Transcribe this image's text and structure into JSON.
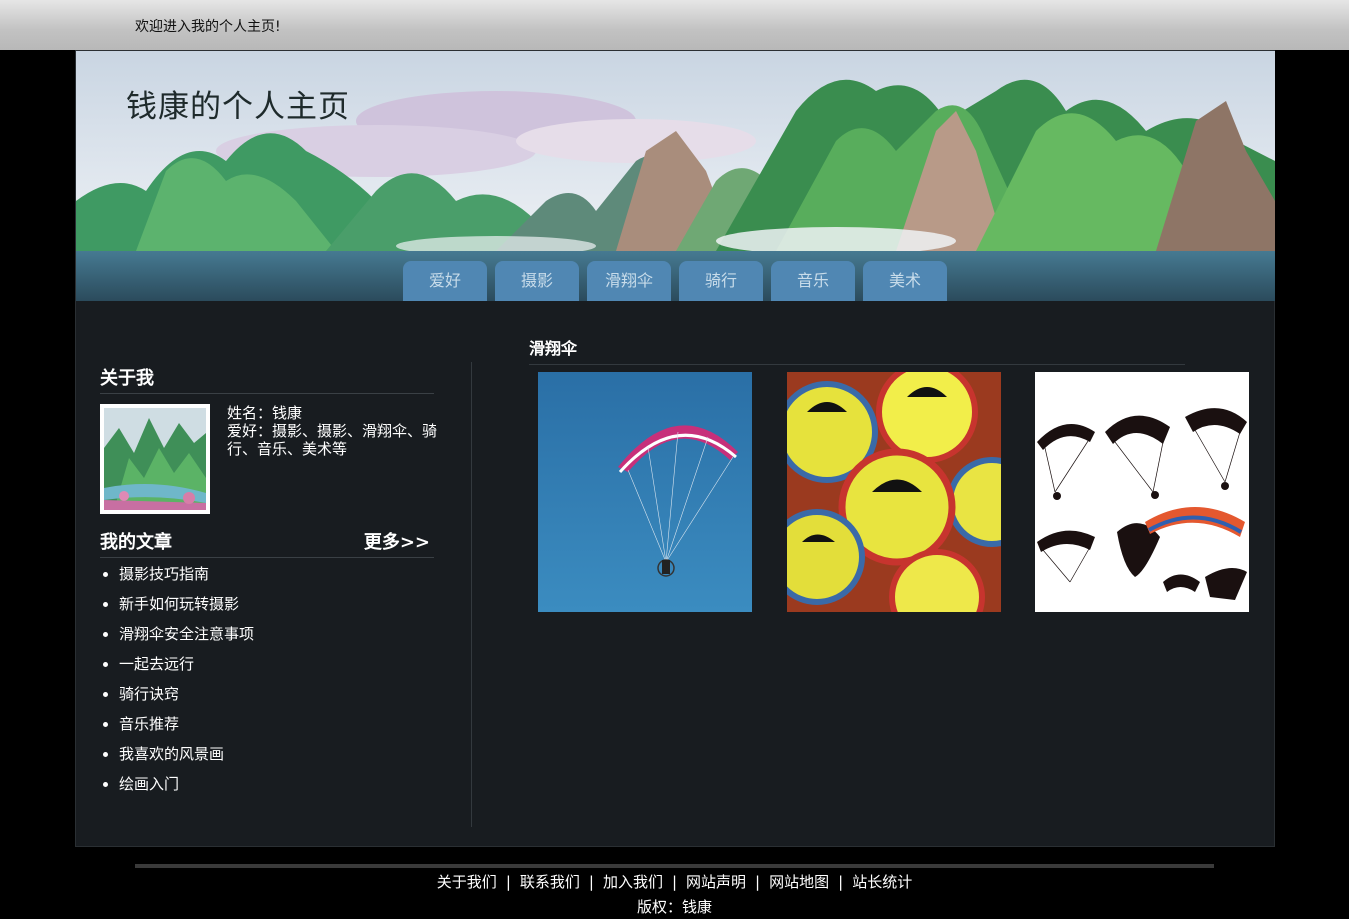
{
  "topbar": {
    "welcome": "欢迎进入我的个人主页!"
  },
  "header": {
    "site_title": "钱康的个人主页"
  },
  "nav": {
    "tabs": [
      {
        "label": "爱好"
      },
      {
        "label": "摄影"
      },
      {
        "label": "滑翔伞"
      },
      {
        "label": "骑行"
      },
      {
        "label": "音乐"
      },
      {
        "label": "美术"
      }
    ]
  },
  "about": {
    "title": "关于我",
    "name_line": "姓名：钱康",
    "hobby_line": "爱好：摄影、摄影、滑翔伞、骑行、音乐、美术等"
  },
  "articles": {
    "title": "我的文章",
    "more": "更多>>",
    "items": [
      "摄影技巧指南",
      "新手如何玩转摄影",
      "滑翔伞安全注意事项",
      "一起去远行",
      "骑行诀窍",
      "音乐推荐",
      "我喜欢的风景画",
      "绘画入门"
    ]
  },
  "content": {
    "title": "滑翔伞"
  },
  "footer": {
    "links": [
      "关于我们",
      "联系我们",
      "加入我们",
      "网站声明",
      "网站地图",
      "站长统计"
    ],
    "separator": "|",
    "copyright": "版权：钱康"
  },
  "colors": {
    "nav_tab": "#5087b3",
    "container_bg": "#181c20",
    "gallery_sky": "#2f7ab0"
  }
}
